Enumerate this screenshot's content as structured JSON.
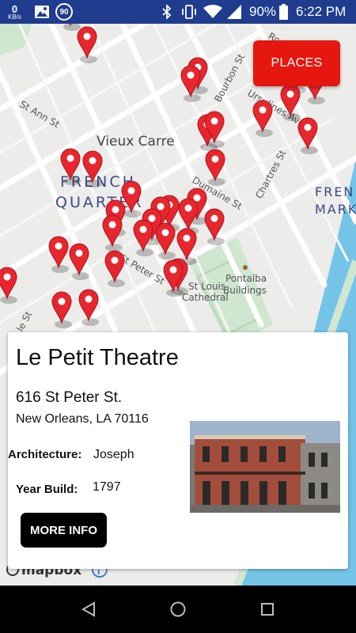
{
  "status_bar": {
    "net_speed_value": "0",
    "net_speed_unit": "KB/s",
    "speed_limit": "90",
    "battery": "90%",
    "time": "6:22 PM"
  },
  "map": {
    "labels": {
      "vieux_carre": "Vieux Carre",
      "french": "FRENCH",
      "quarter": "QUARTER",
      "frenchmen_1": "FREN",
      "frenchmen_2": "MARK",
      "st_ann": "St Ann St",
      "bourbon": "Bourbon St",
      "ursulines": "Ursulines Ave",
      "dumaine": "Dumaine St",
      "chartres": "Chartres St",
      "royal_n": "Royal N",
      "st_peter": "St Peter St",
      "pontalba_1": "Pontalba",
      "pontalba_2": "Buildings",
      "st_louis_1": "St Louis",
      "st_louis_2": "Cathedral",
      "street_left": "le St"
    },
    "attribution": "mapbox"
  },
  "places_button": {
    "label": "PLACES"
  },
  "card": {
    "title": "Le Petit Theatre",
    "address_line1": "616 St Peter St.",
    "address_line2": "New Orleans, LA 70116",
    "architecture_label": "Architecture:",
    "architecture_value": "Joseph",
    "year_label": "Year Build:",
    "year_value": "1797",
    "more_info_label": "MORE INFO"
  },
  "colors": {
    "status_bar": "#1f3c8f",
    "pin": "#e8262e",
    "places_button": "#e5170f",
    "water": "#74c4e8",
    "park": "#cfe6d0",
    "map_bg": "#ececea"
  },
  "icons": [
    "net-speed-icon",
    "image-icon",
    "speed-limit-icon",
    "bluetooth-icon",
    "vibrate-icon",
    "wifi-icon",
    "battery-icon",
    "map-pin-icon",
    "info-icon",
    "back-icon",
    "home-icon",
    "recents-icon"
  ]
}
